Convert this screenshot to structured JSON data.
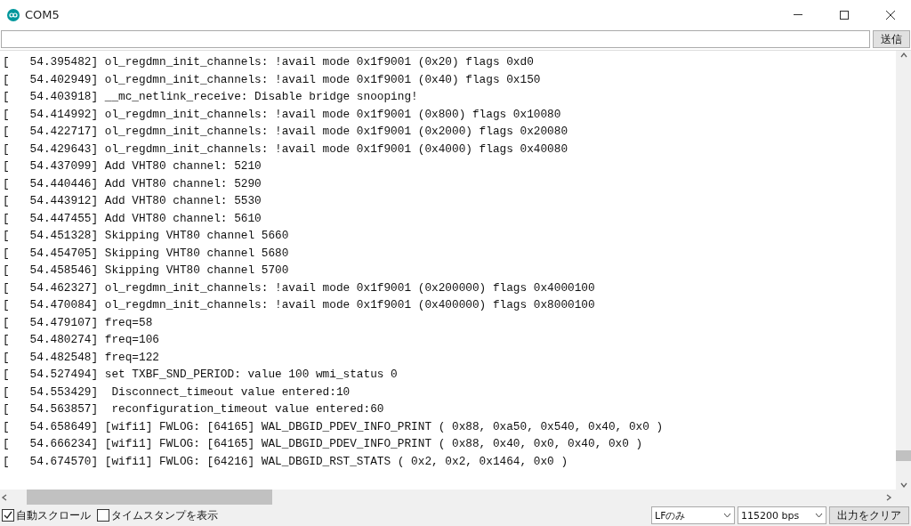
{
  "window": {
    "title": "COM5"
  },
  "input": {
    "send_button": "送信"
  },
  "output_lines": [
    "[   54.395482] ol_regdmn_init_channels: !avail mode 0x1f9001 (0x20) flags 0xd0",
    "[   54.402949] ol_regdmn_init_channels: !avail mode 0x1f9001 (0x40) flags 0x150",
    "[   54.403918] __mc_netlink_receive: Disable bridge snooping!",
    "[   54.414992] ol_regdmn_init_channels: !avail mode 0x1f9001 (0x800) flags 0x10080",
    "[   54.422717] ol_regdmn_init_channels: !avail mode 0x1f9001 (0x2000) flags 0x20080",
    "[   54.429643] ol_regdmn_init_channels: !avail mode 0x1f9001 (0x4000) flags 0x40080",
    "[   54.437099] Add VHT80 channel: 5210",
    "[   54.440446] Add VHT80 channel: 5290",
    "[   54.443912] Add VHT80 channel: 5530",
    "[   54.447455] Add VHT80 channel: 5610",
    "[   54.451328] Skipping VHT80 channel 5660",
    "[   54.454705] Skipping VHT80 channel 5680",
    "[   54.458546] Skipping VHT80 channel 5700",
    "[   54.462327] ol_regdmn_init_channels: !avail mode 0x1f9001 (0x200000) flags 0x4000100",
    "[   54.470084] ol_regdmn_init_channels: !avail mode 0x1f9001 (0x400000) flags 0x8000100",
    "[   54.479107] freq=58",
    "[   54.480274] freq=106",
    "[   54.482548] freq=122",
    "[   54.527494] set TXBF_SND_PERIOD: value 100 wmi_status 0",
    "[   54.553429]  Disconnect_timeout value entered:10",
    "[   54.563857]  reconfiguration_timeout value entered:60",
    "[   54.658649] [wifi1] FWLOG: [64165] WAL_DBGID_PDEV_INFO_PRINT ( 0x88, 0xa50, 0x540, 0x40, 0x0 )",
    "[   54.666234] [wifi1] FWLOG: [64165] WAL_DBGID_PDEV_INFO_PRINT ( 0x88, 0x40, 0x0, 0x40, 0x0 )",
    "[   54.674570] [wifi1] FWLOG: [64216] WAL_DBGID_RST_STATS ( 0x2, 0x2, 0x1464, 0x0 )"
  ],
  "footer": {
    "checkboxes": [
      {
        "label": "自動スクロール",
        "checked": true
      },
      {
        "label": "タイムスタンプを表示",
        "checked": false
      }
    ],
    "selects": [
      {
        "value": "LFのみ"
      },
      {
        "value": "115200 bps"
      }
    ],
    "clear_button": "出力をクリア"
  }
}
